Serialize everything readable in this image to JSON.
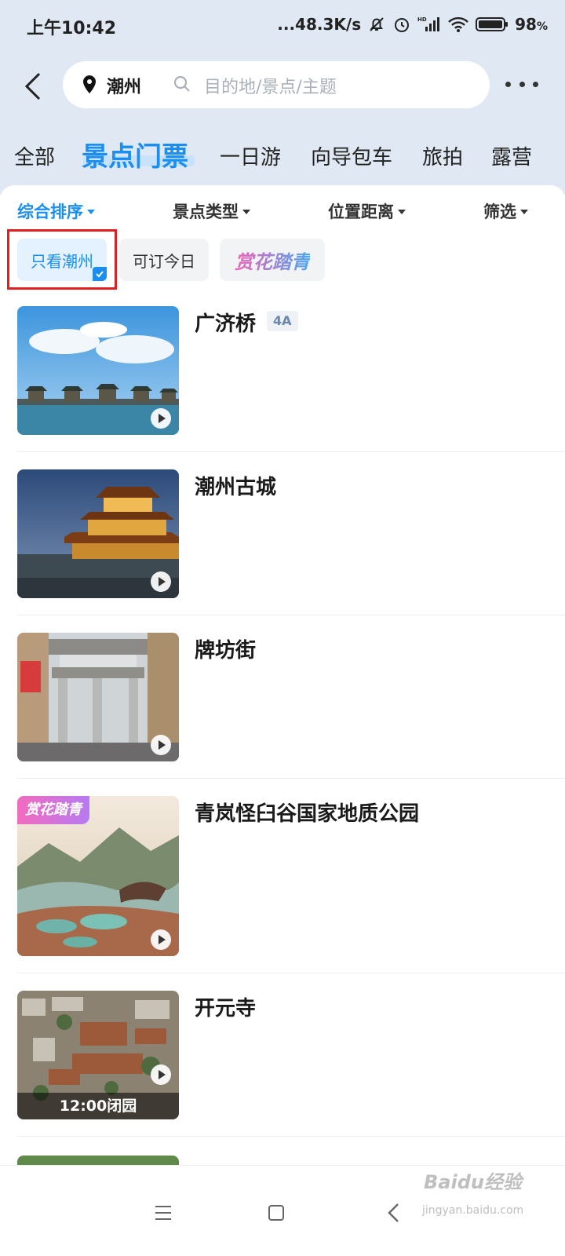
{
  "status_bar": {
    "time": "上午10:42",
    "network_speed": "...48.3K/s",
    "battery": "98",
    "battery_unit": "%",
    "icons": [
      "mute-bell-icon",
      "alarm-icon",
      "hd-signal-icon",
      "wifi-icon",
      "battery-icon"
    ]
  },
  "search": {
    "city": "潮州",
    "placeholder": "目的地/景点/主题"
  },
  "category_tabs": [
    {
      "label": "全部",
      "active": false
    },
    {
      "label": "景点门票",
      "active": true
    },
    {
      "label": "一日游",
      "active": false
    },
    {
      "label": "向导包车",
      "active": false
    },
    {
      "label": "旅拍",
      "active": false
    },
    {
      "label": "露营",
      "active": false
    }
  ],
  "sort_bar": [
    {
      "label": "综合排序",
      "active": true
    },
    {
      "label": "景点类型",
      "active": false
    },
    {
      "label": "位置距离",
      "active": false
    },
    {
      "label": "筛选",
      "active": false
    }
  ],
  "chips": [
    {
      "label": "只看潮州",
      "selected": true
    },
    {
      "label": "可订今日",
      "selected": false
    },
    {
      "label": "赏花踏青",
      "selected": false,
      "style": "gradient"
    }
  ],
  "attractions": [
    {
      "name": "广济桥",
      "grade": "4A",
      "has_video": true
    },
    {
      "name": "潮州古城",
      "grade": "",
      "has_video": true
    },
    {
      "name": "牌坊街",
      "grade": "",
      "has_video": true
    },
    {
      "name": "青岚怪臼谷国家地质公园",
      "grade": "",
      "has_video": true,
      "promo_tag": "赏花踏青"
    },
    {
      "name": "开元寺",
      "grade": "",
      "has_video": true,
      "image_banner": "12:00闭园"
    }
  ],
  "nav_bar": {
    "buttons": [
      "menu-icon",
      "home-square-icon",
      "back-chevron-icon"
    ]
  },
  "watermark": {
    "main": "Baidu经验",
    "sub": "jingyan.baidu.com"
  },
  "colors": {
    "accent": "#1b8ff0",
    "top_bg": "#dfe8f3",
    "highlight_box": "#e02020"
  }
}
